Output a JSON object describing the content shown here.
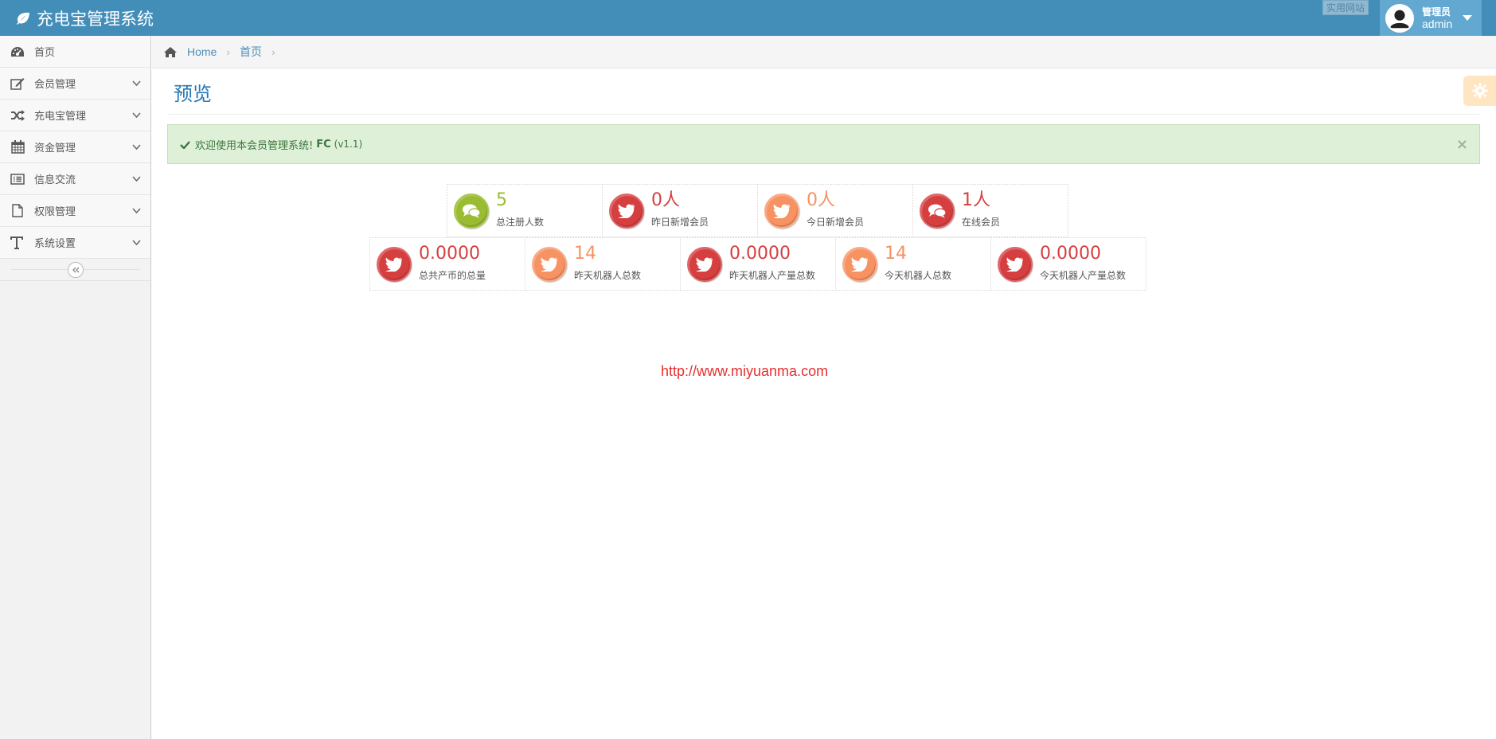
{
  "header": {
    "app_title": "充电宝管理系统",
    "corner_link": "实用网站",
    "user_role": "管理员",
    "user_name": "admin"
  },
  "sidebar": {
    "items": [
      {
        "label": "首页",
        "icon": "dashboard-icon"
      },
      {
        "label": "会员管理",
        "icon": "edit-icon"
      },
      {
        "label": "充电宝管理",
        "icon": "shuffle-icon"
      },
      {
        "label": "资金管理",
        "icon": "calendar-icon"
      },
      {
        "label": "信息交流",
        "icon": "list-alt-icon"
      },
      {
        "label": "权限管理",
        "icon": "file-icon"
      },
      {
        "label": "系统设置",
        "icon": "text-height-icon"
      }
    ]
  },
  "breadcrumbs": {
    "home": "Home",
    "current": "首页"
  },
  "page": {
    "title": "预览"
  },
  "alert": {
    "message": "欢迎使用本会员管理系统!",
    "brand": "FC",
    "version": "(v1.1)",
    "close": "×"
  },
  "stats_row1": [
    {
      "value": "5",
      "label": "总注册人数",
      "icon": "comments-icon",
      "color": "#9abc32"
    },
    {
      "value": "0人",
      "label": "昨日新增会员",
      "icon": "twitter-icon",
      "color": "#d53f40"
    },
    {
      "value": "0人",
      "label": "今日新增会员",
      "icon": "twitter-icon",
      "color": "#f79263"
    },
    {
      "value": "1人",
      "label": "在线会员",
      "icon": "comments-icon",
      "color": "#d53f40"
    }
  ],
  "stats_row2": [
    {
      "value": "0.0000",
      "label": "总共产币的总量",
      "icon": "twitter-icon",
      "color": "#d53f40"
    },
    {
      "value": "14",
      "label": "昨天机器人总数",
      "icon": "twitter-icon",
      "color": "#f79263"
    },
    {
      "value": "0.0000",
      "label": "昨天机器人产量总数",
      "icon": "twitter-icon",
      "color": "#d53f40"
    },
    {
      "value": "14",
      "label": "今天机器人总数",
      "icon": "twitter-icon",
      "color": "#f79263"
    },
    {
      "value": "0.0000",
      "label": "今天机器人产量总数",
      "icon": "twitter-icon",
      "color": "#d53f40"
    }
  ],
  "watermark": "http://www.miyuanma.com",
  "colors": {
    "navbar": "#438eb9",
    "user_menu": "#62a8d1",
    "link": "#4c8fbd",
    "title": "#2679b5",
    "alert_bg": "#dff0d8"
  }
}
